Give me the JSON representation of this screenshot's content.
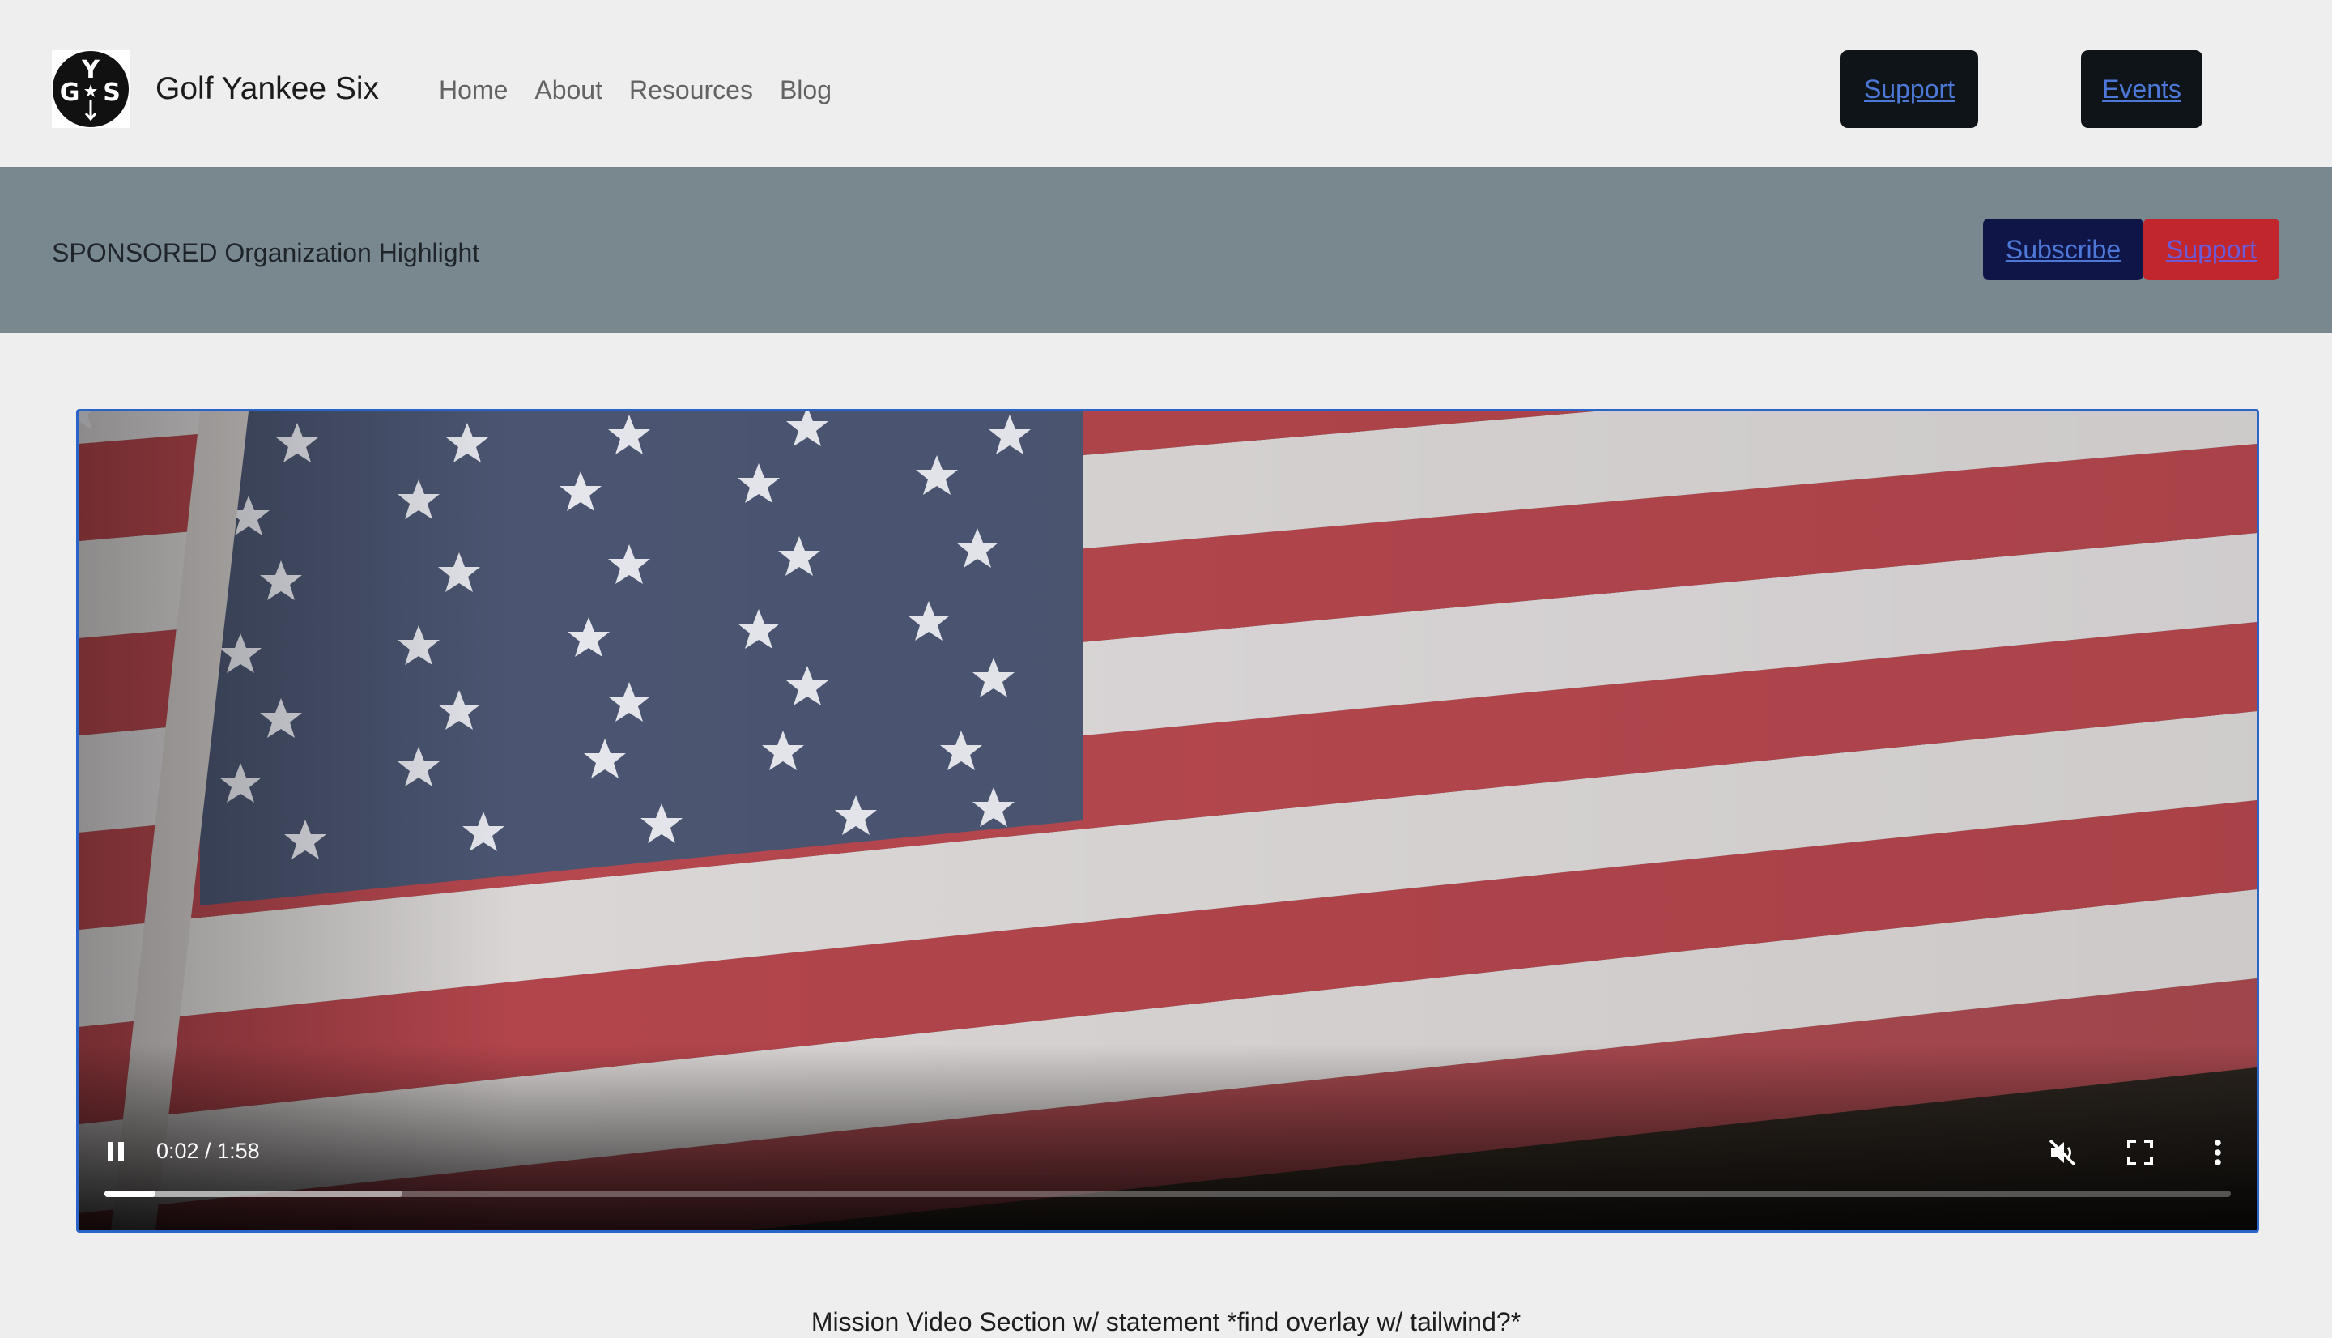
{
  "header": {
    "brand": "Golf Yankee Six",
    "logo_letters": [
      "Y",
      "G",
      "S"
    ],
    "nav": [
      "Home",
      "About",
      "Resources",
      "Blog"
    ],
    "support_label": "Support",
    "events_label": "Events"
  },
  "sponsor": {
    "text": "SPONSORED Organization Highlight",
    "subscribe_label": "Subscribe",
    "support_label": "Support"
  },
  "video": {
    "time": "0:02 / 1:58",
    "played_fraction": 0.024,
    "buffered_fraction": 0.14,
    "muted": true,
    "icons": [
      "pause-icon",
      "volume-muted-icon",
      "fullscreen-icon",
      "more-vert-icon"
    ]
  },
  "caption": "Mission Video Section w/ statement *find overlay w/ tailwind?*"
}
